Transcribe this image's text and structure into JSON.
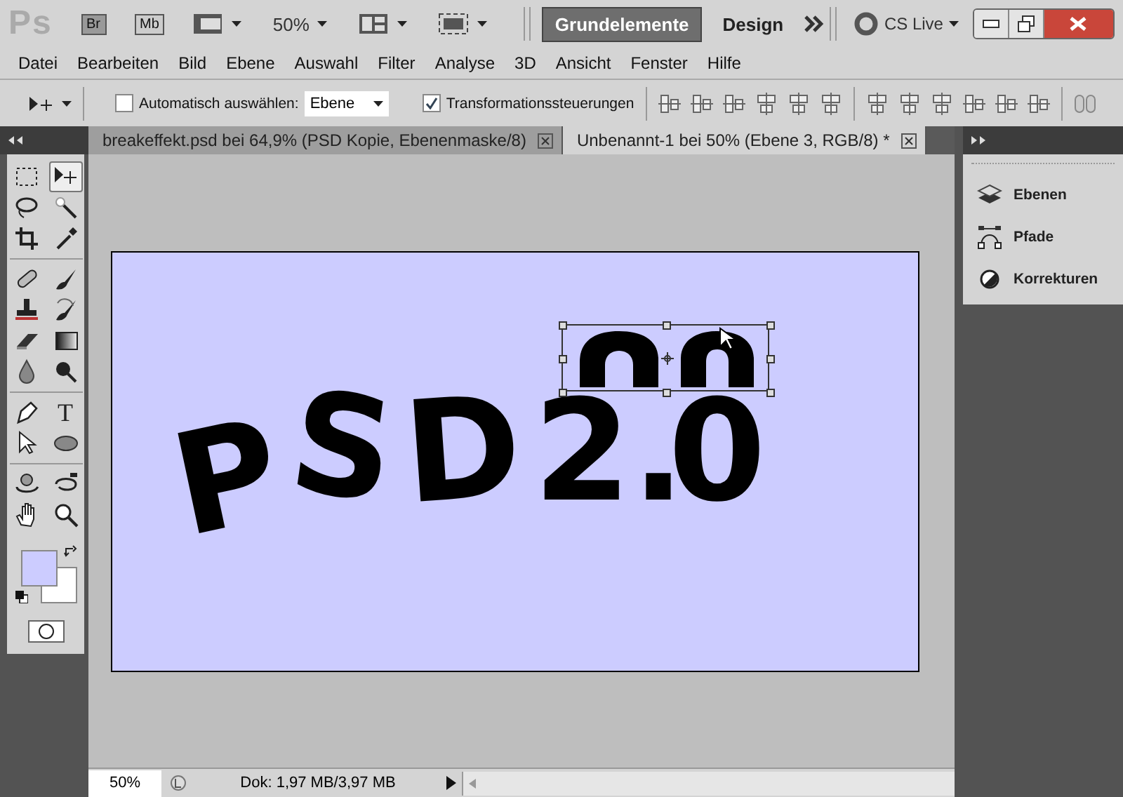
{
  "app_bar": {
    "logo": "Ps",
    "launch_buttons": [
      "Br",
      "Mb"
    ],
    "zoom": "50%",
    "workspaces": [
      {
        "label": "Grundelemente",
        "selected": true
      },
      {
        "label": "Design",
        "selected": false
      }
    ],
    "cs_live": "CS Live"
  },
  "menu": [
    "Datei",
    "Bearbeiten",
    "Bild",
    "Ebene",
    "Auswahl",
    "Filter",
    "Analyse",
    "3D",
    "Ansicht",
    "Fenster",
    "Hilfe"
  ],
  "options_bar": {
    "auto_select": {
      "label": "Automatisch auswählen:",
      "checked": false
    },
    "auto_select_mode": "Ebene",
    "transform_controls": {
      "label": "Transformationssteuerungen",
      "checked": true
    }
  },
  "documents": [
    {
      "title": "breakeffekt.psd bei 64,9% (PSD Kopie, Ebenenmaske/8)",
      "selected": false
    },
    {
      "title": "Unbenannt-1 bei 50% (Ebene 3, RGB/8) *",
      "selected": true
    }
  ],
  "tools": [
    {
      "kind": "marquee",
      "selected": false
    },
    {
      "kind": "move",
      "selected": true
    },
    {
      "kind": "lasso",
      "selected": false
    },
    {
      "kind": "wand",
      "selected": false
    },
    {
      "kind": "crop",
      "selected": false
    },
    {
      "kind": "eyedropper",
      "selected": false
    },
    {
      "kind": "bandage",
      "selected": false
    },
    {
      "kind": "brush",
      "selected": false
    },
    {
      "kind": "stamp",
      "selected": false
    },
    {
      "kind": "history",
      "selected": false
    },
    {
      "kind": "eraser",
      "selected": false
    },
    {
      "kind": "gradient",
      "selected": false
    },
    {
      "kind": "drop",
      "selected": false
    },
    {
      "kind": "dodge",
      "selected": false
    },
    {
      "kind": "pen",
      "selected": false
    },
    {
      "kind": "type",
      "glyph": "T",
      "selected": false
    },
    {
      "kind": "pointer",
      "selected": false
    },
    {
      "kind": "ellipse",
      "selected": false
    },
    {
      "kind": "rotate3d",
      "selected": false
    },
    {
      "kind": "orbit3d",
      "selected": false
    },
    {
      "kind": "hand",
      "selected": false
    },
    {
      "kind": "zoom",
      "selected": false
    }
  ],
  "canvas": {
    "letters": [
      "P",
      "S",
      "D",
      "2",
      ".",
      "0"
    ]
  },
  "panels": [
    {
      "kind": "layers",
      "label": "Ebenen"
    },
    {
      "kind": "paths",
      "label": "Pfade"
    },
    {
      "kind": "adjustments",
      "label": "Korrekturen"
    }
  ],
  "status": {
    "zoom": "50%",
    "doc_info": "Dok: 1,97 MB/3,97 MB"
  }
}
